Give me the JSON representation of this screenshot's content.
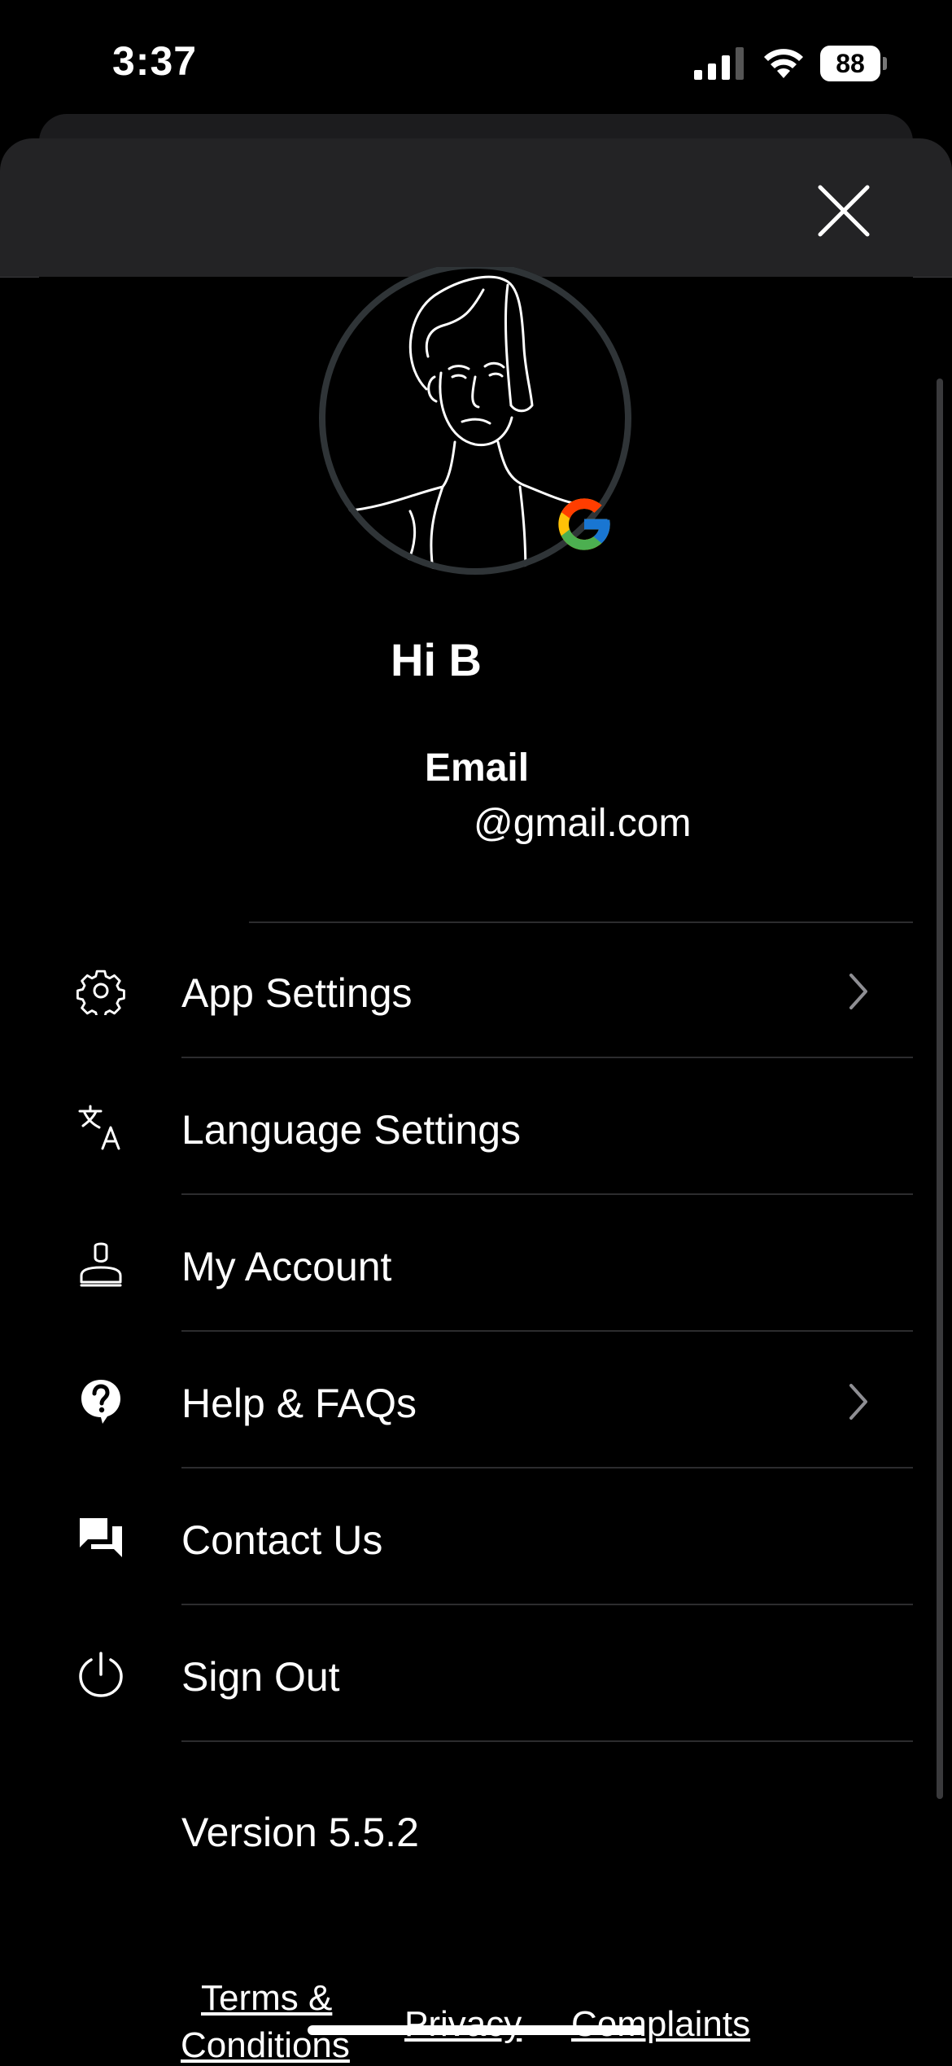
{
  "status_bar": {
    "time": "3:37",
    "battery": "88"
  },
  "profile": {
    "greeting": "Hi B",
    "email_label": "Email",
    "email_value": "@gmail.com",
    "provider_icon": "google-g-icon"
  },
  "menu": {
    "items": [
      {
        "label": "App Settings",
        "icon": "gear-icon",
        "has_chevron": true
      },
      {
        "label": "Language Settings",
        "icon": "translate-icon",
        "has_chevron": false
      },
      {
        "label": "My Account",
        "icon": "person-icon",
        "has_chevron": false
      },
      {
        "label": "Help & FAQs",
        "icon": "help-icon",
        "has_chevron": true
      },
      {
        "label": "Contact Us",
        "icon": "chat-icon",
        "has_chevron": false
      },
      {
        "label": "Sign Out",
        "icon": "power-icon",
        "has_chevron": false
      }
    ]
  },
  "version": "Version 5.5.2",
  "footer": {
    "terms_line1": "Terms &",
    "terms_line2": "Conditions",
    "privacy": "Privacy",
    "complaints": "Complaints"
  },
  "colors": {
    "background": "#000000",
    "header": "#232325",
    "divider": "#2c2c2e"
  }
}
